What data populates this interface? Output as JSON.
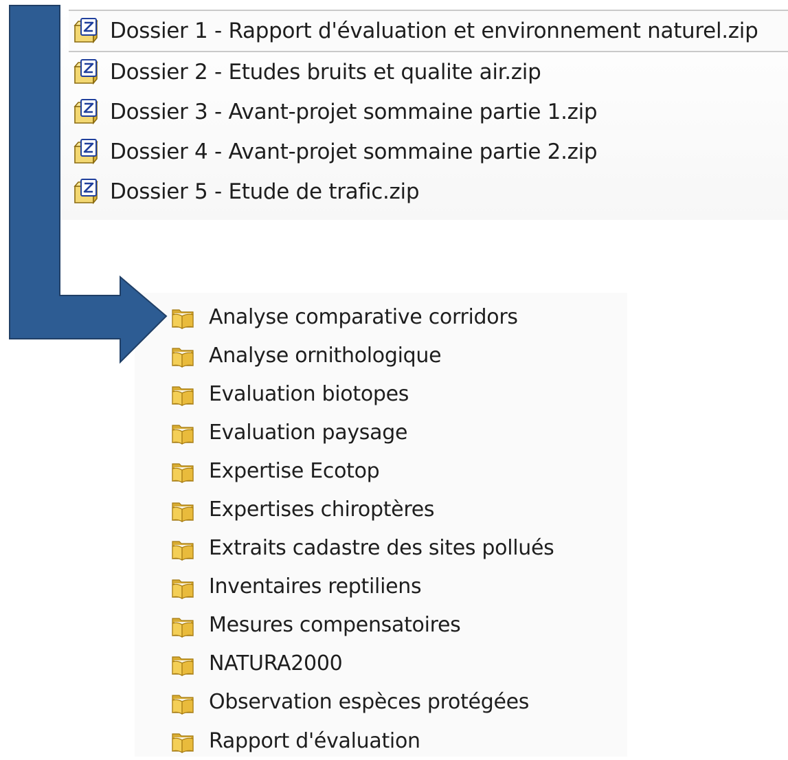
{
  "zip_files": [
    {
      "name": "Dossier 1 - Rapport d'évaluation et environnement naturel.zip",
      "icon": "zip-archive-icon",
      "selected": true
    },
    {
      "name": "Dossier 2 - Etudes bruits et qualite air.zip",
      "icon": "zip-archive-icon",
      "selected": false
    },
    {
      "name": "Dossier 3 - Avant-projet sommaine partie 1.zip",
      "icon": "zip-archive-icon",
      "selected": false
    },
    {
      "name": "Dossier 4 - Avant-projet sommaine partie 2.zip",
      "icon": "zip-archive-icon",
      "selected": false
    },
    {
      "name": "Dossier 5 - Etude de trafic.zip",
      "icon": "zip-archive-icon",
      "selected": false
    }
  ],
  "folders": [
    {
      "name": "Analyse comparative corridors",
      "icon": "folder-icon"
    },
    {
      "name": "Analyse ornithologique",
      "icon": "folder-icon"
    },
    {
      "name": "Evaluation biotopes",
      "icon": "folder-icon"
    },
    {
      "name": "Evaluation paysage",
      "icon": "folder-icon"
    },
    {
      "name": "Expertise Ecotop",
      "icon": "folder-icon"
    },
    {
      "name": "Expertises chiroptères",
      "icon": "folder-icon"
    },
    {
      "name": "Extraits cadastre des sites pollués",
      "icon": "folder-icon"
    },
    {
      "name": "Inventaires reptiliens",
      "icon": "folder-icon"
    },
    {
      "name": "Mesures compensatoires",
      "icon": "folder-icon"
    },
    {
      "name": "NATURA2000",
      "icon": "folder-icon"
    },
    {
      "name": "Observation espèces protégées",
      "icon": "folder-icon"
    },
    {
      "name": "Rapport d'évaluation",
      "icon": "folder-icon"
    }
  ],
  "colors": {
    "arrow": "#2d5c93",
    "arrow_edge": "#203f66"
  }
}
